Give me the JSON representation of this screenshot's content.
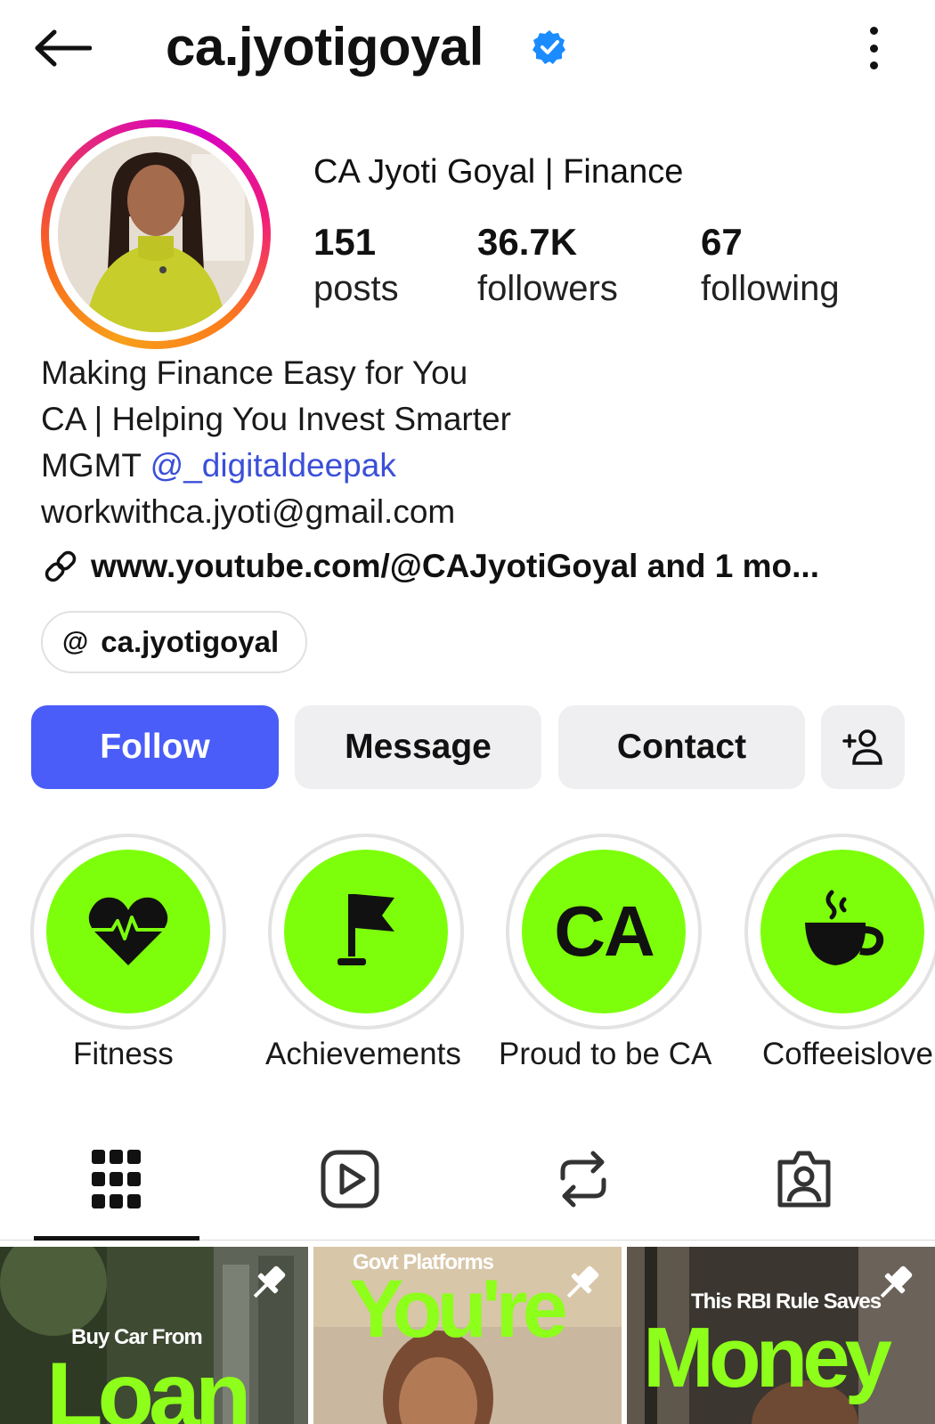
{
  "header": {
    "username": "ca.jyotigoyal",
    "verified_icon": "verified-badge-icon",
    "verified_color": "#1a8cff"
  },
  "profile": {
    "display_name": "CA Jyoti Goyal | Finance",
    "stats": {
      "posts": {
        "value": "151",
        "label": "posts"
      },
      "followers": {
        "value": "36.7K",
        "label": "followers"
      },
      "following": {
        "value": "67",
        "label": "following"
      }
    },
    "bio": {
      "line1": "Making Finance Easy for You",
      "line2": "CA | Helping You Invest Smarter",
      "line3_prefix": "MGMT ",
      "line3_mention": "@_digitaldeepak",
      "line4": "workwithca.jyoti@gmail.com"
    },
    "link": "www.youtube.com/@CAJyotiGoyal and 1 mo...",
    "threads_handle": "ca.jyotigoyal"
  },
  "actions": {
    "follow": "Follow",
    "message": "Message",
    "contact": "Contact",
    "follow_color": "#4a5df9"
  },
  "highlights": [
    {
      "label": "Fitness",
      "icon": "heart-pulse-icon"
    },
    {
      "label": "Achievements",
      "icon": "flag-icon"
    },
    {
      "label": "Proud to be CA",
      "icon_text": "CA"
    },
    {
      "label": "Coffeeislove",
      "icon": "coffee-cup-icon"
    }
  ],
  "highlight_color": "#7dff0c",
  "tabs": [
    {
      "name": "posts-grid",
      "icon": "grid-icon",
      "active": true
    },
    {
      "name": "reels",
      "icon": "reels-play-icon",
      "active": false
    },
    {
      "name": "reposts",
      "icon": "repost-icon",
      "active": false
    },
    {
      "name": "tagged",
      "icon": "tagged-person-icon",
      "active": false
    }
  ],
  "posts": [
    {
      "caption": "Buy Car From",
      "headline": "Loan",
      "pinned": true
    },
    {
      "caption": "Govt Platforms",
      "headline": "You're",
      "pinned": true
    },
    {
      "caption": "This RBI Rule Saves",
      "headline": "Money",
      "pinned": true
    }
  ]
}
